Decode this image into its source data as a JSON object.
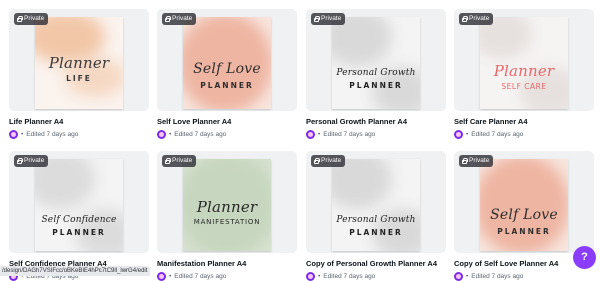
{
  "designs": [
    {
      "title": "Life Planner A4",
      "privacy": "Private",
      "edited": "Edited 7 days ago",
      "cover": {
        "script": "Planner",
        "caps": "LIFE",
        "script_color": "#3a3a3a",
        "caps_color": "#3a3a3a",
        "wash": "#f2c7a8",
        "bg": "#fbf3ee",
        "layout": "script-top"
      }
    },
    {
      "title": "Self Love Planner A4",
      "privacy": "Private",
      "edited": "Edited 7 days ago",
      "cover": {
        "script": "Self Love",
        "caps": "PLANNER",
        "script_color": "#2e2e2e",
        "caps_color": "#2e2e2e",
        "wash": "#eeb5a2",
        "bg": "#f8e6df",
        "layout": "script-top"
      }
    },
    {
      "title": "Personal Growth Planner A4",
      "privacy": "Private",
      "edited": "Edited 7 days ago",
      "cover": {
        "script": "Personal Growth",
        "caps": "PLANNER",
        "script_color": "#222222",
        "caps_color": "#222222",
        "wash": "#d9d9d9",
        "bg": "#f4f4f4",
        "layout": "script-top"
      }
    },
    {
      "title": "Self Care Planner A4",
      "privacy": "Private",
      "edited": "Edited 7 days ago",
      "cover": {
        "script": "Planner",
        "caps": "SELF CARE",
        "script_color": "#e8676b",
        "caps_color": "#e8676b",
        "wash": "#e6e0de",
        "bg": "#f6f4f3",
        "layout": "script-top"
      }
    },
    {
      "title": "Self Confidence Planner A4",
      "privacy": "Private",
      "edited": "Edited 7 days ago",
      "cover": {
        "script": "Self Confidence",
        "caps": "PLANNER",
        "script_color": "#222222",
        "caps_color": "#222222",
        "wash": "#dcdcdc",
        "bg": "#f4f4f4",
        "layout": "script-top"
      }
    },
    {
      "title": "Manifestation Planner A4",
      "privacy": "Private",
      "edited": "Edited 7 days ago",
      "cover": {
        "script": "Planner",
        "caps": "MANIFESTATION",
        "script_color": "#2a2a2a",
        "caps_color": "#2a2a2a",
        "wash": "#c7d6bf",
        "bg": "#d7e2d0",
        "layout": "script-top"
      }
    },
    {
      "title": "Copy of Personal Growth Planner A4",
      "privacy": "Private",
      "edited": "Edited 7 days ago",
      "cover": {
        "script": "Personal Growth",
        "caps": "PLANNER",
        "script_color": "#222222",
        "caps_color": "#222222",
        "wash": "#d9d9d9",
        "bg": "#f4f4f4",
        "layout": "script-top"
      }
    },
    {
      "title": "Copy of Self Love Planner A4",
      "privacy": "Private",
      "edited": "Edited 7 days ago",
      "cover": {
        "script": "Self Love",
        "caps": "PLANNER",
        "script_color": "#2e2e2e",
        "caps_color": "#2e2e2e",
        "wash": "#eeb5a2",
        "bg": "#f8e6df",
        "layout": "script-top"
      }
    }
  ],
  "status_url": "/design/DAGh7VSIFcc/oBKeBIE4hPc7tC9ll_lwrG4/edit",
  "help_button": "?",
  "colors": {
    "accent": "#8b3dff",
    "owner_avatar": "#7d2ae8",
    "badge_bg": "#2a2a30"
  }
}
